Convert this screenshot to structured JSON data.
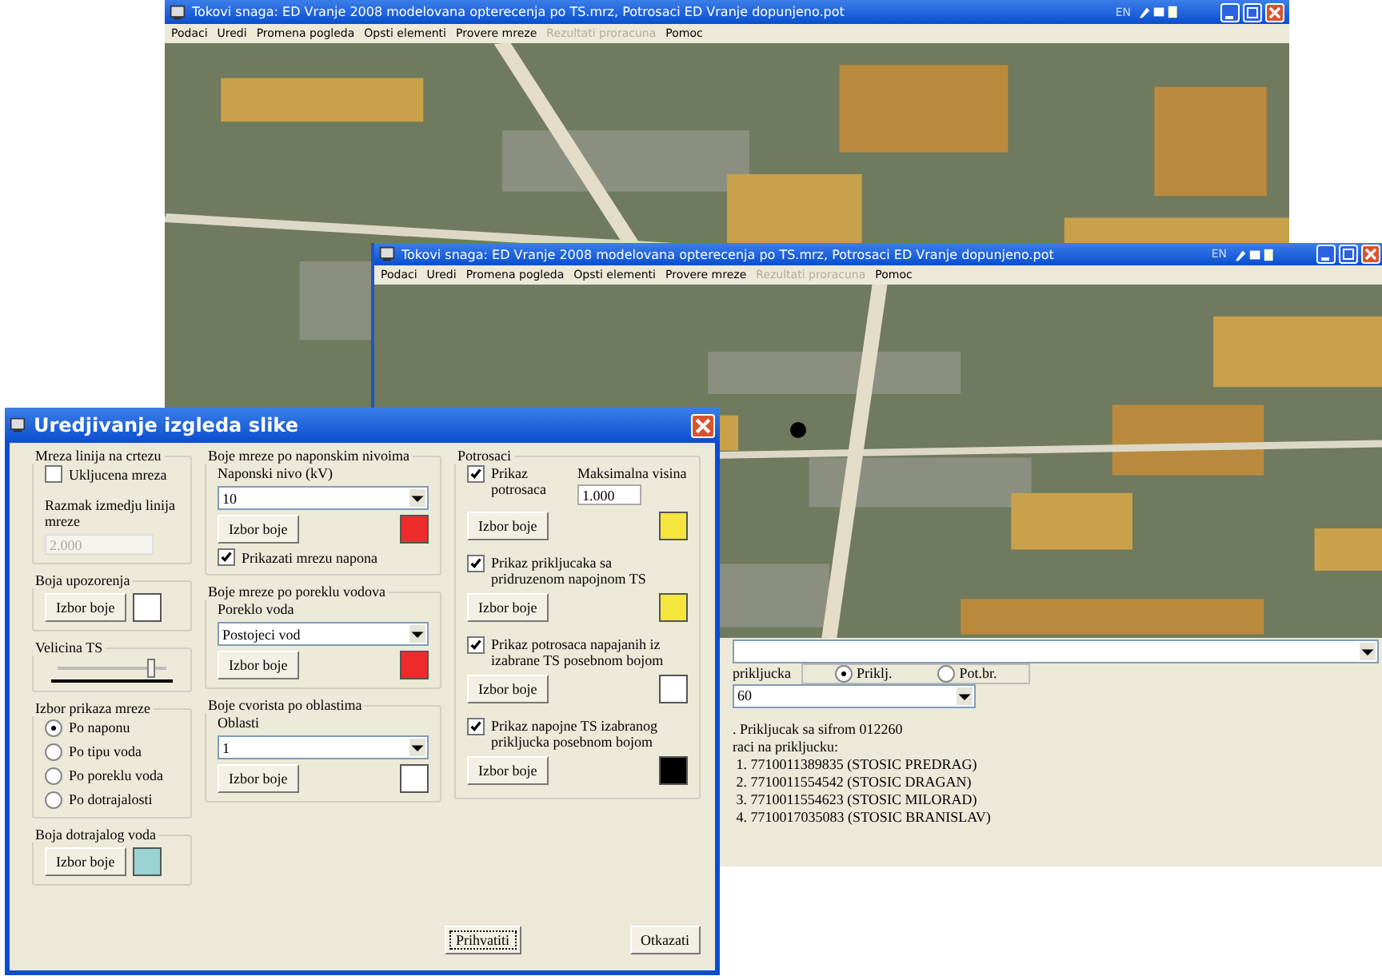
{
  "back_window": {
    "title": "Tokovi snaga: ED Vranje 2008  modelovana opterecenja po TS.mrz, Potrosaci ED Vranje dopunjeno.pot",
    "language": "EN",
    "menu": [
      {
        "label": "Podaci",
        "disabled": false
      },
      {
        "label": "Uredi",
        "disabled": false
      },
      {
        "label": "Promena pogleda",
        "disabled": false
      },
      {
        "label": "Opsti elementi",
        "disabled": false
      },
      {
        "label": "Provere mreze",
        "disabled": false
      },
      {
        "label": "Rezultati proracuna",
        "disabled": true
      },
      {
        "label": "Pomoc",
        "disabled": false
      }
    ]
  },
  "front_window": {
    "title": "Tokovi snaga: ED Vranje 2008  modelovana opterecenja po TS.mrz, Potrosaci ED Vranje dopunjeno.pot",
    "language": "EN",
    "menu": [
      {
        "label": "Podaci",
        "disabled": false
      },
      {
        "label": "Uredi",
        "disabled": false
      },
      {
        "label": "Promena pogleda",
        "disabled": false
      },
      {
        "label": "Opsti elementi",
        "disabled": false
      },
      {
        "label": "Provere mreze",
        "disabled": false
      },
      {
        "label": "Rezultati proracuna",
        "disabled": true
      },
      {
        "label": "Pomoc",
        "disabled": false
      }
    ],
    "search_label": "prikljucka",
    "search_modes": [
      {
        "label": "Priklj.",
        "selected": true
      },
      {
        "label": "Pot.br.",
        "selected": false
      }
    ],
    "search_value": "60",
    "info_lines": [
      ". Prikljucak sa sifrom 012260",
      "raci na prikljucku:",
      " 1. 7710011389835 (STOSIC PREDRAG)",
      " 2. 7710011554542 (STOSIC DRAGAN)",
      " 3. 7710011554623 (STOSIC MILORAD)",
      " 4. 7710017035083 (STOSIC BRANISLAV)"
    ]
  },
  "dialog": {
    "title": "Uredjivanje izgleda slike",
    "grid_group": {
      "title": "Mreza linija na crtezu",
      "checkbox": {
        "label": "Ukljucena mreza",
        "checked": false
      },
      "spacing_label": "Razmak izmedju linija mreze",
      "spacing_value": "2.000",
      "disabled": true
    },
    "warning_color": {
      "title": "Boja upozorenja",
      "button": "Izbor boje",
      "color": "#ffffff"
    },
    "ts_size": {
      "title": "Velicina TS",
      "level": 0.85
    },
    "display_mode": {
      "title": "Izbor prikaza mreze",
      "options": [
        {
          "label": "Po naponu",
          "selected": true
        },
        {
          "label": "Po tipu voda",
          "selected": false
        },
        {
          "label": "Po poreklu voda",
          "selected": false
        },
        {
          "label": "Po dotrajalosti",
          "selected": false
        }
      ]
    },
    "worn_color": {
      "title": "Boja dotrajalog voda",
      "button": "Izbor boje",
      "color": "#99d3d3"
    },
    "voltage_group": {
      "title": "Boje mreze po naponskim nivoima",
      "field_label": "Naponski nivo (kV)",
      "value": "10",
      "button": "Izbor boje",
      "color": "#ee2b2b",
      "checkbox": {
        "label": "Prikazati mrezu napona",
        "checked": true
      }
    },
    "origin_group": {
      "title": "Boje mreze po poreklu vodova",
      "field_label": "Poreklo voda",
      "value": "Postojeci vod",
      "button": "Izbor boje",
      "color": "#ee2b2b"
    },
    "area_group": {
      "title": "Boje cvorista po oblastima",
      "field_label": "Oblasti",
      "value": "1",
      "button": "Izbor boje",
      "color": "#ffffff"
    },
    "consumers": {
      "title": "Potrosaci",
      "max_label": "Maksimalna visina",
      "max_value": "1.000",
      "items": [
        {
          "label": "Prikaz potrosaca",
          "checked": true,
          "button": "Izbor boje",
          "color": "#f5e53c"
        },
        {
          "label": "Prikaz prikljucaka sa pridruzenom napojnom TS",
          "checked": true,
          "button": "Izbor boje",
          "color": "#f5e53c"
        },
        {
          "label": "Prikaz potrosaca napajanih iz izabrane TS posebnom bojom",
          "checked": true,
          "button": "Izbor boje",
          "color": "#ffffff"
        },
        {
          "label": "Prikaz napojne TS izabranog prikljucka posebnom bojom",
          "checked": true,
          "button": "Izbor boje",
          "color": "#000000"
        }
      ]
    },
    "ok_button": "Prihvatiti",
    "cancel_button": "Otkazati"
  }
}
